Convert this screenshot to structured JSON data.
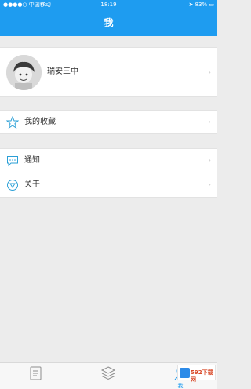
{
  "status_bar": {
    "carrier": "●●●●○ 中国移动",
    "time": "18:19",
    "battery": "83%"
  },
  "header": {
    "title": "我"
  },
  "profile": {
    "name": "瑞安三中"
  },
  "menu": {
    "favorites_label": "我的收藏",
    "notice_label": "通知",
    "about_label": "关于"
  },
  "tabbar": {
    "tabs": [
      {
        "icon": "document-icon",
        "label": ""
      },
      {
        "icon": "layers-icon",
        "label": ""
      },
      {
        "icon": "person-icon",
        "label": "我"
      }
    ]
  },
  "watermark": {
    "text": "592下载网"
  },
  "colors": {
    "accent": "#1e9cf0",
    "background": "#ececec"
  }
}
